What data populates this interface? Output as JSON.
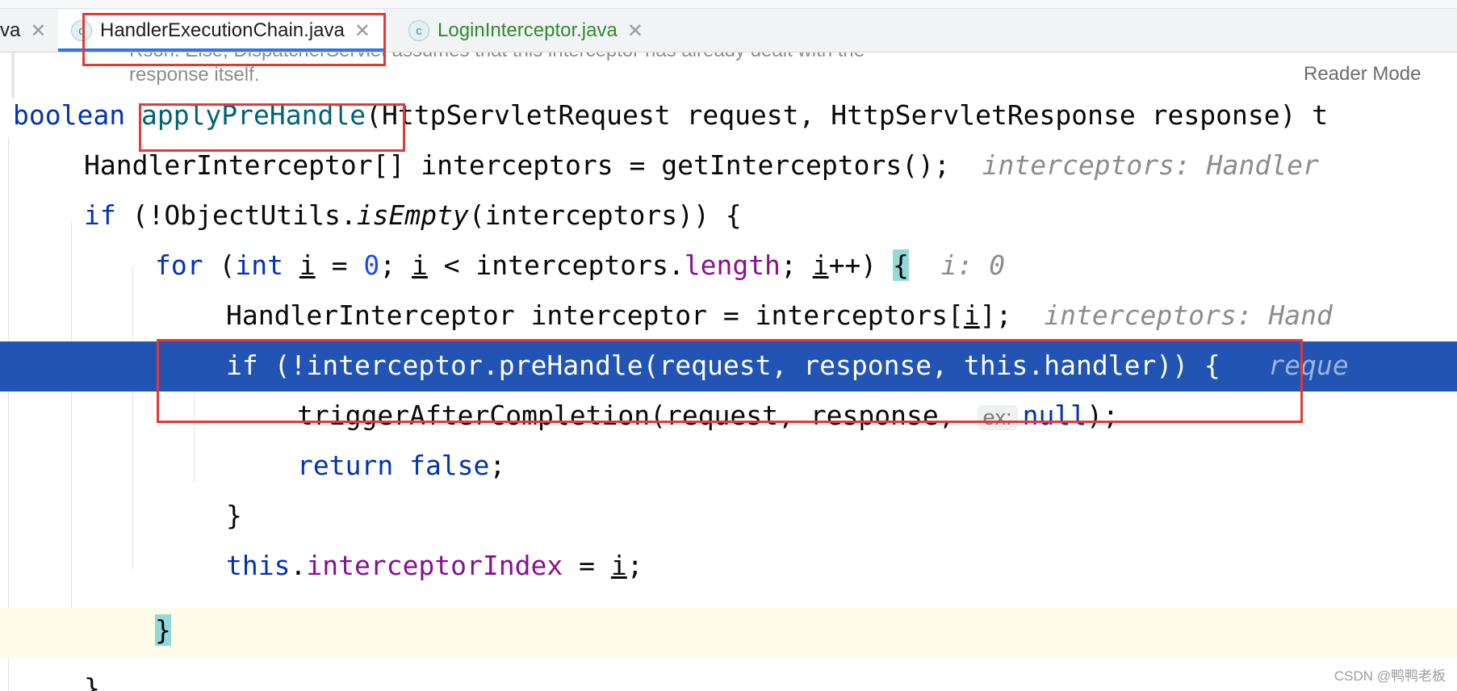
{
  "tabs": [
    {
      "label": "va",
      "icon": "class-icon",
      "active": false
    },
    {
      "label": "HandlerExecutionChain.java",
      "icon": "class-icon",
      "active": true
    },
    {
      "label": "LoginInterceptor.java",
      "icon": "class-icon",
      "active": false
    }
  ],
  "doc": {
    "line1": "Rsoh. Else, DispatcherServlet assumes that this interceptor has already dealt with the",
    "line2": "response itself.",
    "reader_mode": "Reader Mode"
  },
  "code": {
    "l1_kw": "boolean ",
    "l1_fn": "applyPreHandle",
    "l1_rest": "(HttpServletRequest request, HttpServletResponse response) t",
    "l2": "HandlerInterceptor[] interceptors = getInterceptors();",
    "l2_hint": "interceptors: Handler",
    "l3_kw": "if ",
    "l3_a": "(!ObjectUtils.",
    "l3_it": "isEmpty",
    "l3_b": "(interceptors)) {",
    "l4_kw": "for ",
    "l4_a": "(",
    "l4_kw2": "int ",
    "l4_i": "i",
    "l4_b": " = ",
    "l4_num": "0",
    "l4_c": "; ",
    "l4_d": " < interceptors.",
    "l4_field": "length",
    "l4_e": "; ",
    "l4_f": "++) ",
    "l4_brace": "{",
    "l4_hint": "i: 0",
    "l5_a": "HandlerInterceptor interceptor = interceptors[",
    "l5_b": "];",
    "l5_hint": "interceptors: Hand",
    "l6": "if (!interceptor.preHandle(request, response, this.handler)) {",
    "l6_hint": "reque",
    "l7_a": "triggerAfterCompletion(request, response,",
    "l7_inlay": "ex:",
    "l7_kw": "null",
    "l7_b": ");",
    "l8_kw": "return false",
    "l8_b": ";",
    "l9": "}",
    "l10_kw": "this",
    "l10_a": ".",
    "l10_field": "interceptorIndex",
    "l10_b": " = ",
    "l10_c": ";",
    "l11": "}",
    "l12": "}"
  },
  "watermark": "CSDN @鸭鸭老板"
}
